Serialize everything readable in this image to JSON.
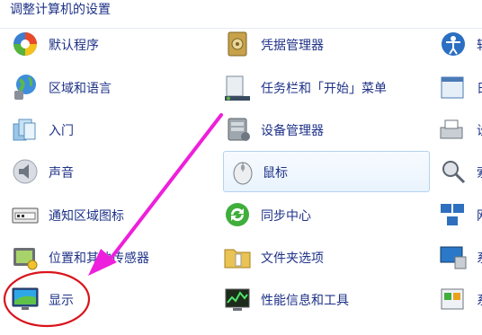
{
  "header": {
    "title": "调整计算机的设置"
  },
  "col1": [
    {
      "label": "默认程序",
      "icon": "default-programs-icon"
    },
    {
      "label": "区域和语言",
      "icon": "region-language-icon"
    },
    {
      "label": "入门",
      "icon": "getting-started-icon"
    },
    {
      "label": "声音",
      "icon": "sound-icon"
    },
    {
      "label": "通知区域图标",
      "icon": "notification-area-icon"
    },
    {
      "label": "位置和其他传感器",
      "icon": "location-sensors-icon"
    },
    {
      "label": "显示",
      "icon": "display-icon"
    }
  ],
  "col2": [
    {
      "label": "凭据管理器",
      "icon": "credential-manager-icon"
    },
    {
      "label": "任务栏和「开始」菜单",
      "icon": "taskbar-start-menu-icon"
    },
    {
      "label": "设备管理器",
      "icon": "device-manager-icon"
    },
    {
      "label": "鼠标",
      "icon": "mouse-icon"
    },
    {
      "label": "同步中心",
      "icon": "sync-center-icon"
    },
    {
      "label": "文件夹选项",
      "icon": "folder-options-icon"
    },
    {
      "label": "性能信息和工具",
      "icon": "performance-tools-icon"
    }
  ],
  "col3": [
    {
      "label": "轻",
      "icon": "ease-of-access-icon"
    },
    {
      "label": "日",
      "icon": "date-time-icon"
    },
    {
      "label": "设",
      "icon": "devices-printers-icon"
    },
    {
      "label": "索",
      "icon": "indexing-options-icon"
    },
    {
      "label": "网",
      "icon": "network-icon"
    },
    {
      "label": "系",
      "icon": "system-icon"
    },
    {
      "label": "系",
      "icon": "system-tools-icon"
    }
  ],
  "annotation": {
    "color": "#ee1fdc",
    "circle_color": "#d9141b"
  }
}
